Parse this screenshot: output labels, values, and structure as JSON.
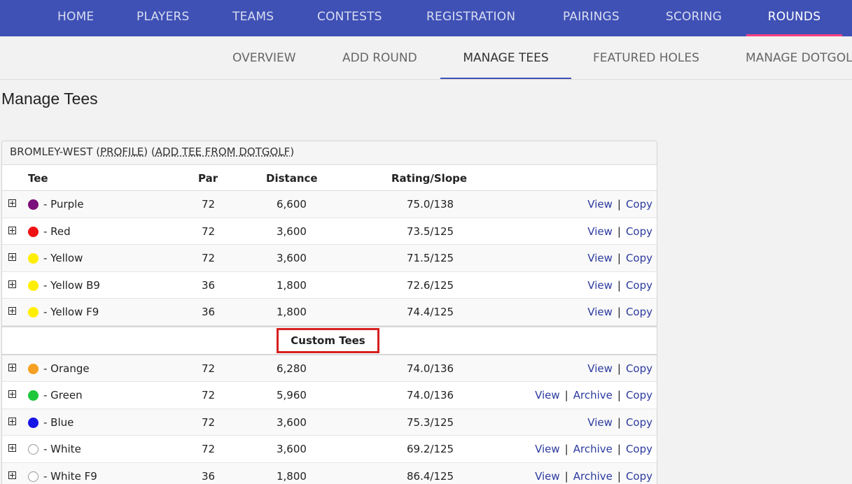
{
  "topnav": {
    "items": [
      {
        "label": "HOME"
      },
      {
        "label": "PLAYERS"
      },
      {
        "label": "TEAMS"
      },
      {
        "label": "CONTESTS"
      },
      {
        "label": "REGISTRATION"
      },
      {
        "label": "PAIRINGS"
      },
      {
        "label": "SCORING"
      },
      {
        "label": "ROUNDS"
      }
    ],
    "active": "ROUNDS"
  },
  "subnav": {
    "items": [
      {
        "label": "OVERVIEW"
      },
      {
        "label": "ADD ROUND"
      },
      {
        "label": "MANAGE TEES"
      },
      {
        "label": "FEATURED HOLES"
      },
      {
        "label": "MANAGE DOTGOLF"
      }
    ],
    "active": "MANAGE TEES"
  },
  "page": {
    "title": "Manage Tees"
  },
  "course": {
    "name": "BROMLEY-WEST",
    "profile_label": "PROFILE",
    "add_tee_label": "ADD TEE FROM DOTGOLF"
  },
  "table": {
    "headers": {
      "tee": "Tee",
      "par": "Par",
      "distance": "Distance",
      "rating": "Rating/Slope"
    },
    "tees": [
      {
        "color": "#7b0f7b",
        "name": "- Purple",
        "par": "72",
        "distance": "6,600",
        "rating": "75.0/138",
        "view": "View",
        "copy": "Copy"
      },
      {
        "color": "#ee1111",
        "name": "- Red",
        "par": "72",
        "distance": "3,600",
        "rating": "73.5/125",
        "view": "View",
        "copy": "Copy"
      },
      {
        "color": "#ffee00",
        "name": "- Yellow",
        "par": "72",
        "distance": "3,600",
        "rating": "71.5/125",
        "view": "View",
        "copy": "Copy"
      },
      {
        "color": "#ffee00",
        "name": "- Yellow B9",
        "par": "36",
        "distance": "1,800",
        "rating": "72.6/125",
        "view": "View",
        "copy": "Copy"
      },
      {
        "color": "#ffee00",
        "name": "- Yellow F9",
        "par": "36",
        "distance": "1,800",
        "rating": "74.4/125",
        "view": "View",
        "copy": "Copy"
      }
    ],
    "custom_label": "Custom Tees",
    "custom_tees": [
      {
        "color": "#f5a023",
        "name": "- Orange",
        "par": "72",
        "distance": "6,280",
        "rating": "74.0/136",
        "view": "View",
        "copy": "Copy"
      },
      {
        "color": "#1fc73a",
        "name": "- Green",
        "par": "72",
        "distance": "5,960",
        "rating": "74.0/136",
        "view": "View",
        "archive": "Archive",
        "copy": "Copy"
      },
      {
        "color": "#1515e6",
        "name": "- Blue",
        "par": "72",
        "distance": "3,600",
        "rating": "75.3/125",
        "view": "View",
        "copy": "Copy"
      },
      {
        "color": "#ffffff",
        "name": "- White",
        "par": "72",
        "distance": "3,600",
        "rating": "69.2/125",
        "view": "View",
        "archive": "Archive",
        "copy": "Copy"
      },
      {
        "color": "#ffffff",
        "name": "- White F9",
        "par": "36",
        "distance": "1,800",
        "rating": "86.4/125",
        "view": "View",
        "archive": "Archive",
        "copy": "Copy"
      }
    ],
    "separator": "|"
  }
}
